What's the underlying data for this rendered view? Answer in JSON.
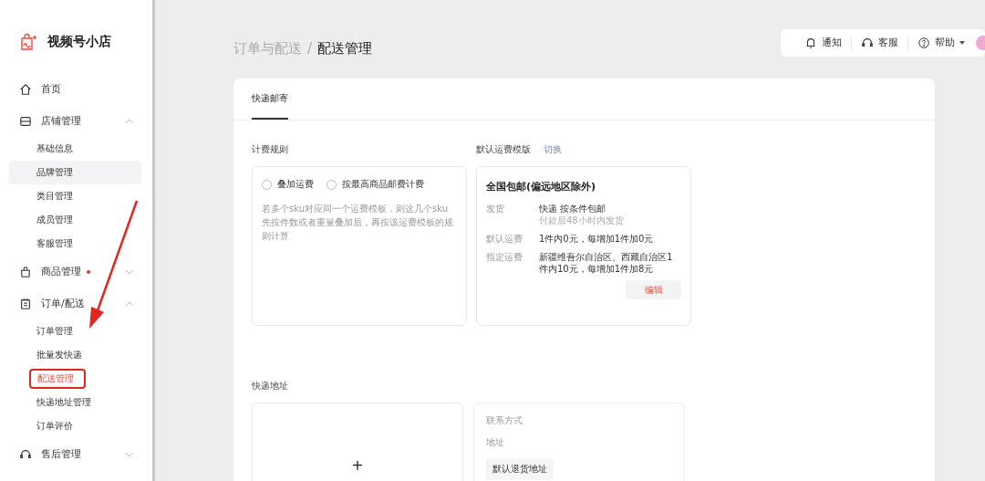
{
  "brand": {
    "name": "视频号小店"
  },
  "sidebar": {
    "items": [
      {
        "kind": "home",
        "label": "首页",
        "dot": false
      },
      {
        "kind": "store",
        "label": "店铺管理",
        "expandable": true,
        "expanded": true,
        "dot": false,
        "children": [
          {
            "label": "基础信息",
            "selected": false,
            "hovered": false,
            "outlined": false
          },
          {
            "label": "品牌管理",
            "selected": false,
            "hovered": true,
            "outlined": false
          },
          {
            "label": "类目管理",
            "selected": false,
            "hovered": false,
            "outlined": false
          },
          {
            "label": "成员管理",
            "selected": false,
            "hovered": false,
            "outlined": false
          },
          {
            "label": "客服管理",
            "selected": false,
            "hovered": false,
            "outlined": false
          }
        ]
      },
      {
        "kind": "bag",
        "label": "商品管理",
        "expandable": true,
        "expanded": false,
        "dot": true
      },
      {
        "kind": "clipboard",
        "label": "订单/配送",
        "expandable": true,
        "expanded": true,
        "dot": false,
        "children": [
          {
            "label": "订单管理",
            "selected": false,
            "hovered": false,
            "outlined": false
          },
          {
            "label": "批量发快递",
            "selected": false,
            "hovered": false,
            "outlined": false
          },
          {
            "label": "配送管理",
            "selected": true,
            "hovered": false,
            "outlined": true
          },
          {
            "label": "快递地址管理",
            "selected": false,
            "hovered": false,
            "outlined": false
          },
          {
            "label": "订单评价",
            "selected": false,
            "hovered": false,
            "outlined": false
          }
        ]
      },
      {
        "kind": "headset",
        "label": "售后管理",
        "expandable": true,
        "expanded": false,
        "dot": false
      }
    ]
  },
  "breadcrumb": {
    "parent": "订单与配送",
    "separator": "/",
    "current": "配送管理"
  },
  "toolbar": [
    {
      "kind": "bell",
      "label": "通知",
      "dropdown": false
    },
    {
      "kind": "headset",
      "label": "客服",
      "dropdown": false
    },
    {
      "kind": "help",
      "label": "帮助",
      "dropdown": true
    }
  ],
  "tabs": [
    {
      "label": "快递邮寄",
      "selected": true
    }
  ],
  "billing": {
    "title": "计费规则",
    "options": [
      {
        "label": "叠加运费",
        "selected": false
      },
      {
        "label": "按最高商品邮费计费",
        "selected": false
      }
    ],
    "note": "若多个sku对应同一个运费模板，则这几个sku先按件数或者重量叠加后，再按该运费模板的规则计算"
  },
  "template": {
    "title": "默认运费模版",
    "switch_link": "切换",
    "name": "全国包邮(偏远地区除外)",
    "rows": [
      {
        "label": "发货",
        "value": "快递 按条件包邮",
        "sub": "付款后48小时内发货"
      },
      {
        "label": "默认运费",
        "value": "1件内0元，每增加1件加0元"
      },
      {
        "label": "指定运费",
        "value": "新疆维吾尔自治区、西藏自治区1件内10元，每增加1件加8元"
      }
    ],
    "edit_button": "编辑"
  },
  "address": {
    "title": "快递地址",
    "add_symbol": "+",
    "contact_label": "联系方式",
    "address_label": "地址",
    "tag": "默认退货地址"
  }
}
